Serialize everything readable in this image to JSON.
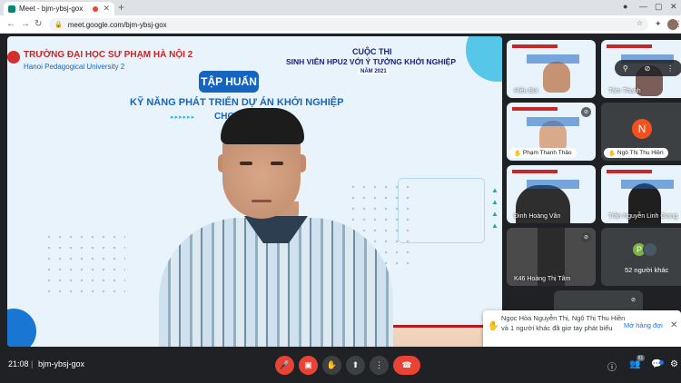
{
  "browser": {
    "tab_title": "Meet - bjm-ybsj-gox",
    "url": "meet.google.com/bjm-ybsj-gox",
    "new_tab": "+"
  },
  "slide": {
    "university_vn": "TRƯỜNG ĐẠI HỌC SƯ PHẠM HÀ NỘI 2",
    "university_en": "Hanoi Pedagogical University 2",
    "contest_title": "CUỘC THI",
    "contest_subtitle": "SINH VIÊN HPU2 VỚI Ý TƯỞNG KHỞI NGHIỆP",
    "year": "NĂM 2021",
    "training": "TẬP HUẤN",
    "heading": "KỸ NĂNG PHÁT TRIỂN DỰ ÁN KHỞI NGHIỆP",
    "subheading": "CHO SI",
    "arrows": "▸▸▸▸▸▸"
  },
  "participants": [
    {
      "name": "Hiếu Bùi",
      "type": "video"
    },
    {
      "name": "Tâm Thanh",
      "type": "video"
    },
    {
      "name": "Phạm Thanh Thảo",
      "type": "video",
      "hand_raised": true
    },
    {
      "name": "Ngô Thị Thu Hiền",
      "type": "avatar",
      "initial": "N",
      "hand_raised": true
    },
    {
      "name": "Đinh Hoàng Vân",
      "type": "video"
    },
    {
      "name": "Trần Nguyễn Linh Giang",
      "type": "video"
    },
    {
      "name": "K46 Hoàng Thị Tâm",
      "type": "video"
    },
    {
      "name": "52 người khác",
      "type": "others",
      "initial": "P"
    }
  ],
  "notification": {
    "text": "Ngọc Hòa Nguyễn Thị, Ngô Thị Thu Hiền và 1 người khác đã giơ tay phát biểu",
    "action": "Mở hàng đợi"
  },
  "bottom_bar": {
    "time": "21:08",
    "separator": "|",
    "meeting_code": "bjm-ybsj-gox",
    "people_count": "61"
  },
  "colors": {
    "end_call": "#ea4335",
    "meet_bg": "#202124",
    "accent": "#1a73e8"
  }
}
